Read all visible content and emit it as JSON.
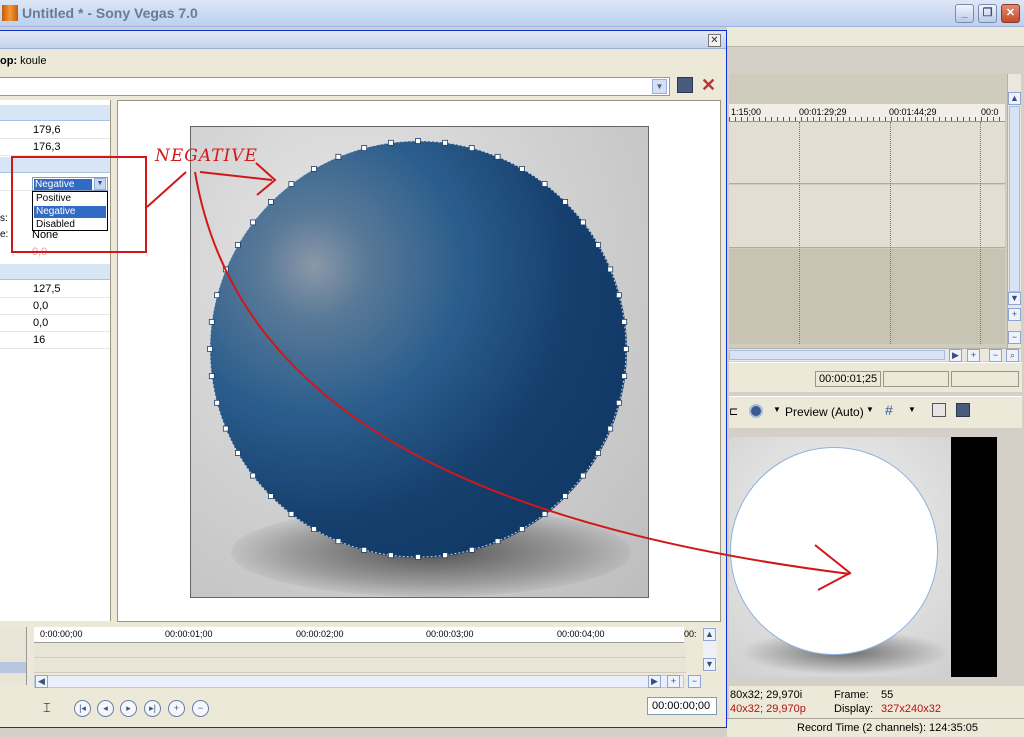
{
  "window": {
    "title": "Untitled * - Sony Vegas 7.0"
  },
  "dialog": {
    "subtitle_prefix": "op:",
    "subtitle_value": "koule",
    "preset_value": ""
  },
  "props": {
    "rows_top": [
      "179,6",
      "176,3"
    ],
    "dropdown": {
      "selected": "Negative",
      "options": [
        "Positive",
        "Negative",
        "Disabled"
      ]
    },
    "partial_label_1": "s:",
    "partial_label_2": "e:",
    "value_none": "None",
    "value_faded": "0,0",
    "rows_bottom": [
      "127,5",
      "0,0",
      "0,0",
      "16"
    ]
  },
  "annotation": {
    "text": "NEGATIVE"
  },
  "dialog_timeline": {
    "ruler_ticks": [
      "0:00:00;00",
      "00:00:01;00",
      "00:00:02;00",
      "00:00:03;00",
      "00:00:04;00",
      "00:"
    ],
    "timecode": "00:00:00;00"
  },
  "main_timeline": {
    "ruler_ticks": [
      "1:15;00",
      "00:01:29;29",
      "00:01:44;29",
      "00:0"
    ],
    "cursor_time": "00:00:01;25"
  },
  "preview": {
    "mode": "Preview (Auto)",
    "info_left_1": "80x32; 29,970i",
    "info_left_2": "40x32; 29,970p",
    "frame_label": "Frame:",
    "frame_value": "55",
    "display_label": "Display:",
    "display_value": "327x240x32"
  },
  "status": {
    "record_time": "Record Time (2 channels): 124:35:05"
  },
  "colors": {
    "accent": "#316ac5",
    "annotation": "#d01818",
    "sphere": "#1b4775"
  }
}
